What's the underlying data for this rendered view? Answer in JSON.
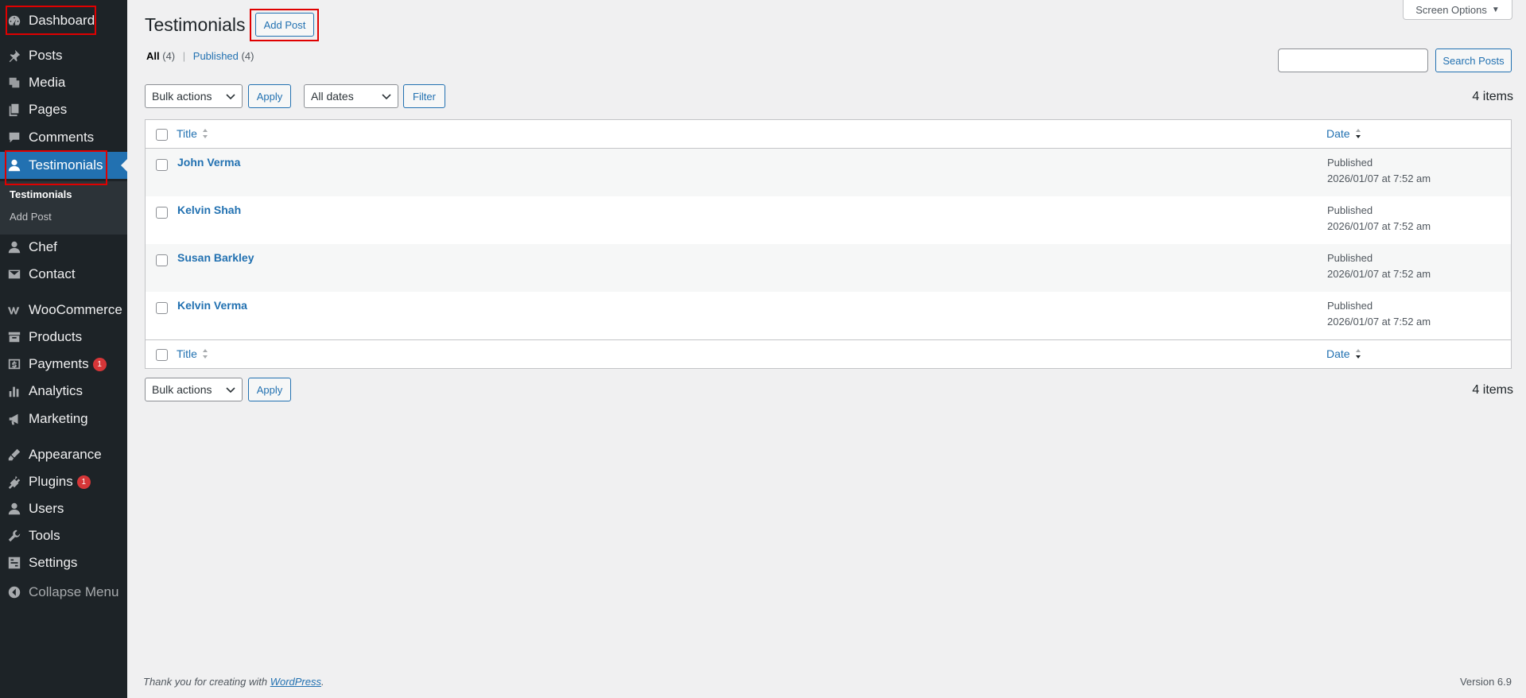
{
  "sidebar": {
    "items": [
      {
        "label": "Dashboard",
        "icon": "dashboard-icon"
      },
      {
        "label": "Posts",
        "icon": "pin-icon"
      },
      {
        "label": "Media",
        "icon": "media-icon"
      },
      {
        "label": "Pages",
        "icon": "pages-icon"
      },
      {
        "label": "Comments",
        "icon": "comment-icon"
      },
      {
        "label": "Testimonials",
        "icon": "user-icon"
      },
      {
        "label": "Chef",
        "icon": "user-icon"
      },
      {
        "label": "Contact",
        "icon": "mail-icon"
      },
      {
        "label": "WooCommerce",
        "icon": "woo-icon"
      },
      {
        "label": "Products",
        "icon": "archive-icon"
      },
      {
        "label": "Payments",
        "icon": "dollar-icon",
        "badge": "1"
      },
      {
        "label": "Analytics",
        "icon": "chart-icon"
      },
      {
        "label": "Marketing",
        "icon": "megaphone-icon"
      },
      {
        "label": "Appearance",
        "icon": "brush-icon"
      },
      {
        "label": "Plugins",
        "icon": "plug-icon",
        "badge": "1"
      },
      {
        "label": "Users",
        "icon": "user-icon"
      },
      {
        "label": "Tools",
        "icon": "wrench-icon"
      },
      {
        "label": "Settings",
        "icon": "settings-icon"
      }
    ],
    "submenu": [
      "Testimonials",
      "Add Post"
    ],
    "collapse_label": "Collapse Menu"
  },
  "header": {
    "title": "Testimonials",
    "add_post_label": "Add Post",
    "screen_options_label": "Screen Options"
  },
  "filters": {
    "all_label": "All",
    "all_count": "(4)",
    "published_label": "Published",
    "published_count": "(4)",
    "search_placeholder": "",
    "search_button": "Search Posts",
    "bulk_actions": "Bulk actions",
    "apply_label": "Apply",
    "dates_select": "All dates",
    "filter_label": "Filter",
    "items_count": "4 items"
  },
  "table": {
    "columns": {
      "title": "Title",
      "date": "Date"
    },
    "rows": [
      {
        "title": "John Verma",
        "status": "Published",
        "date": "2026/01/07 at 7:52 am"
      },
      {
        "title": "Kelvin Shah",
        "status": "Published",
        "date": "2026/01/07 at 7:52 am"
      },
      {
        "title": "Susan Barkley",
        "status": "Published",
        "date": "2026/01/07 at 7:52 am"
      },
      {
        "title": "Kelvin Verma",
        "status": "Published",
        "date": "2026/01/07 at 7:52 am"
      }
    ]
  },
  "footer": {
    "thanks_prefix": "Thank you for creating with ",
    "thanks_link": "WordPress",
    "thanks_suffix": ".",
    "version": "Version 6.9"
  },
  "colors": {
    "sidebar_bg": "#1d2327",
    "accent": "#2271b1",
    "badge": "#d63638",
    "highlight_box": "#e00000"
  }
}
